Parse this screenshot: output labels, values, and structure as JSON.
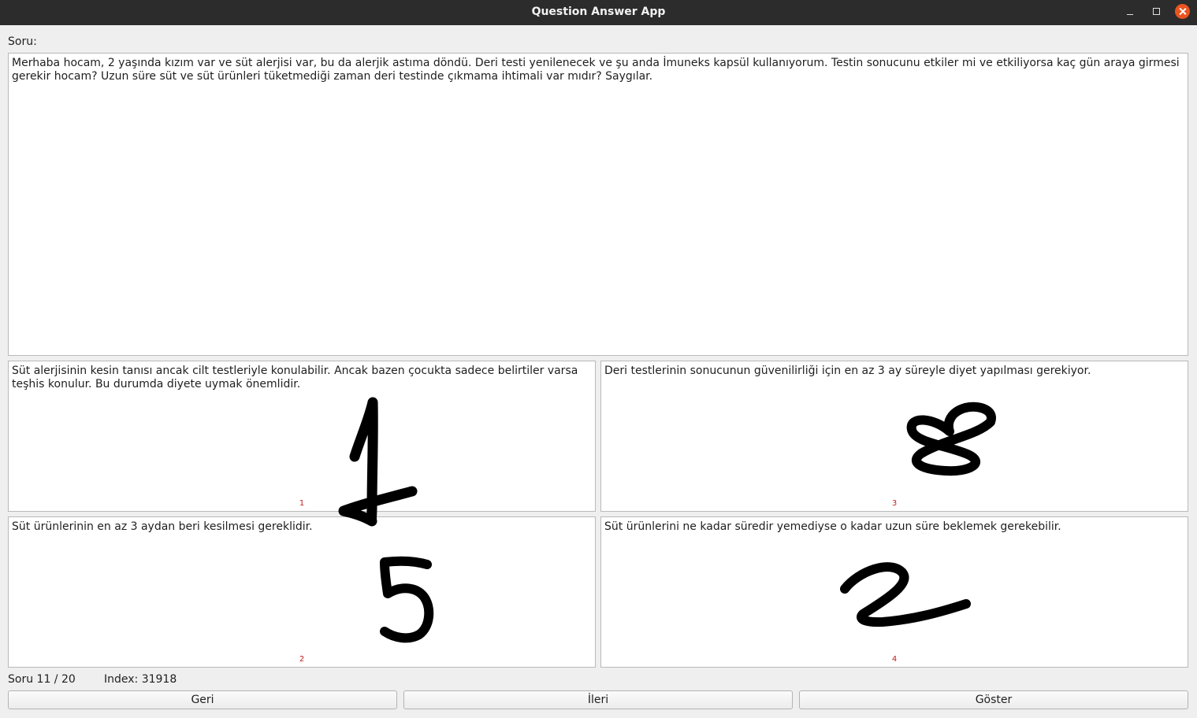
{
  "window": {
    "title": "Question Answer App",
    "controls": [
      "minimize-icon",
      "maximize-icon",
      "close-icon"
    ],
    "close_color": "#e95420"
  },
  "question": {
    "label": "Soru:",
    "text": "Merhaba hocam, 2 yaşında kızım var ve süt alerjisi var, bu da alerjik astıma döndü. Deri testi yenilenecek ve şu anda İmuneks kapsül kullanıyorum. Testin sonucunu etkiler mi ve etkiliyorsa kaç gün araya girmesi gerekir hocam? Uzun süre süt ve süt ürünleri tüketmediği zaman deri testinde çıkmama ihtimali var mıdır? Saygılar."
  },
  "answers": [
    {
      "text": "Süt alerjisinin kesin tanısı ancak cilt testleriyle konulabilir. Ancak bazen çocukta sadece belirtiler varsa teşhis konulur. Bu durumda diyete uymak önemlidir.",
      "number": "1",
      "handwritten_rank": "1"
    },
    {
      "text": "Deri testlerinin sonucunun güvenilirliği için en az 3 ay süreyle diyet yapılması gerekiyor.",
      "number": "3",
      "handwritten_rank": "8"
    },
    {
      "text": "Süt ürünlerinin en az 3 aydan beri kesilmesi gereklidir.",
      "number": "2",
      "handwritten_rank": "5"
    },
    {
      "text": "Süt ürünlerini ne kadar süredir yemediyse o kadar uzun süre beklemek gerekebilir.",
      "number": "4",
      "handwritten_rank": "2"
    }
  ],
  "status": {
    "progress": "Soru 11 / 20",
    "index": "Index: 31918"
  },
  "buttons": {
    "back": "Geri",
    "next": "İleri",
    "show": "Göster"
  },
  "colors": {
    "answer_number": "#c02020",
    "titlebar": "#2c2c2c",
    "background": "#efefef"
  }
}
